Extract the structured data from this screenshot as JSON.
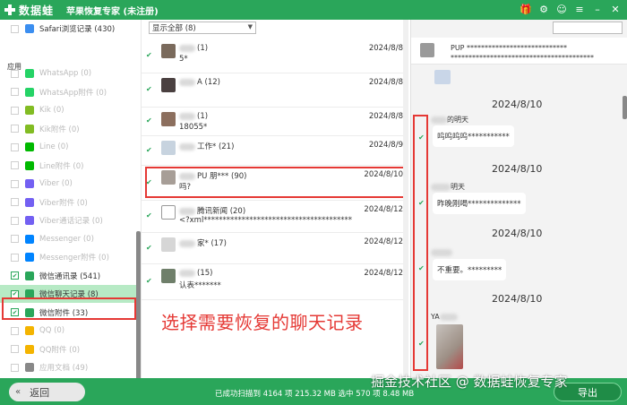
{
  "titlebar": {
    "logo_text": "数据蛙",
    "title": "苹果恢复专家 (未注册)",
    "icons": [
      "gift-icon",
      "settings-icon",
      "chat-icon",
      "menu-icon",
      "minimize-icon",
      "close-icon"
    ]
  },
  "sidebar": {
    "top_item": "Safari浏览记录 (430)",
    "section": "应用",
    "items": [
      {
        "label": "WhatsApp (0)",
        "color": "#25d366",
        "checked": false
      },
      {
        "label": "WhatsApp附件 (0)",
        "color": "#25d366",
        "checked": false
      },
      {
        "label": "Kik (0)",
        "color": "#82bc23",
        "checked": false
      },
      {
        "label": "Kik附件 (0)",
        "color": "#82bc23",
        "checked": false
      },
      {
        "label": "Line (0)",
        "color": "#00b900",
        "checked": false
      },
      {
        "label": "Line附件 (0)",
        "color": "#00b900",
        "checked": false
      },
      {
        "label": "Viber (0)",
        "color": "#7360f2",
        "checked": false
      },
      {
        "label": "Viber附件 (0)",
        "color": "#7360f2",
        "checked": false
      },
      {
        "label": "Viber通话记录 (0)",
        "color": "#7360f2",
        "checked": false
      },
      {
        "label": "Messenger (0)",
        "color": "#0084ff",
        "checked": false
      },
      {
        "label": "Messenger附件 (0)",
        "color": "#0084ff",
        "checked": false
      },
      {
        "label": "微信通讯录 (541)",
        "color": "#2aa65a",
        "checked": true
      },
      {
        "label": "微信聊天记录 (8)",
        "color": "#2aa65a",
        "checked": true
      },
      {
        "label": "微信附件 (33)",
        "color": "#2aa65a",
        "checked": true
      },
      {
        "label": "QQ (0)",
        "color": "#f4b400",
        "checked": false
      },
      {
        "label": "QQ附件 (0)",
        "color": "#f4b400",
        "checked": false
      },
      {
        "label": "应用文档 (49)",
        "color": "#888888",
        "checked": false
      }
    ]
  },
  "middle": {
    "filter_value": "显示全部 (8)",
    "rows": [
      {
        "name": "(1)",
        "preview": "5*",
        "date": "2024/8/8"
      },
      {
        "name": "A (12)",
        "preview": "",
        "date": "2024/8/8"
      },
      {
        "name": "(1)",
        "preview": "18055*",
        "date": "2024/8/8"
      },
      {
        "name": "工作* (21)",
        "preview": "",
        "date": "2024/8/9"
      },
      {
        "name": "PU 朋*** (90)",
        "preview": "吗?",
        "date": "2024/8/10"
      },
      {
        "name": "腾讯新闻 (20)",
        "preview": "<?xml***************************************",
        "date": "2024/8/12"
      },
      {
        "name": "家* (17)",
        "preview": "",
        "date": "2024/8/12"
      },
      {
        "name": "(15)",
        "preview": "认表*******",
        "date": "2024/8/12"
      }
    ],
    "overlay": "选择需要恢复的聊天记录"
  },
  "right": {
    "search_placeholder": "",
    "header_line1": "PUP ****************************",
    "header_line2": "****************************************",
    "dates": [
      "2024/8/10",
      "2024/8/10",
      "2024/8/10",
      "2024/8/10"
    ],
    "names": [
      "的明天",
      "明天",
      "",
      "YA"
    ],
    "bubbles": [
      "呜呜呜呜***********",
      "昨晚刚喝**************",
      "不重要。*********"
    ]
  },
  "bottom": {
    "back_label": "返回",
    "status": "已成功扫描到 4164 项 215.32 MB   选中 570 项 8.48 MB",
    "export_label": "导出"
  },
  "watermark": "掘金技术社区 @ 数据蛙恢复专家"
}
